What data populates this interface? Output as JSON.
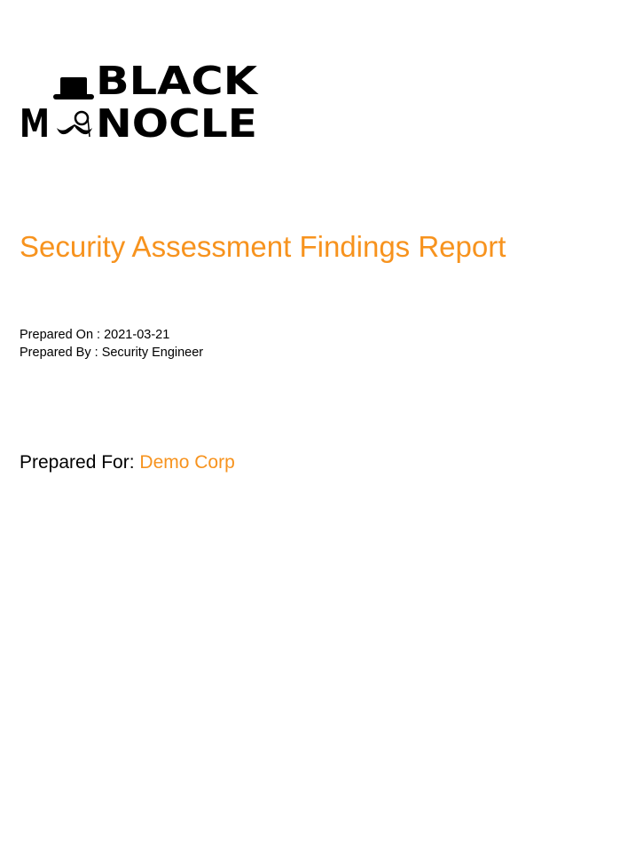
{
  "logo": {
    "line1": "BLACK",
    "line2_left": "M",
    "line2_right": "NOCLE",
    "icon": "top-hat-monocle-mustache-icon"
  },
  "title": "Security Assessment Findings Report",
  "meta": {
    "prepared_on_label": "Prepared On : ",
    "prepared_on_value": "2021-03-21",
    "prepared_by_label": "Prepared By : ",
    "prepared_by_value": "Security Engineer"
  },
  "prepared_for": {
    "label": "Prepared For: ",
    "value": "Demo Corp"
  },
  "colors": {
    "accent": "#f7931e",
    "text": "#000000",
    "background": "#ffffff"
  }
}
